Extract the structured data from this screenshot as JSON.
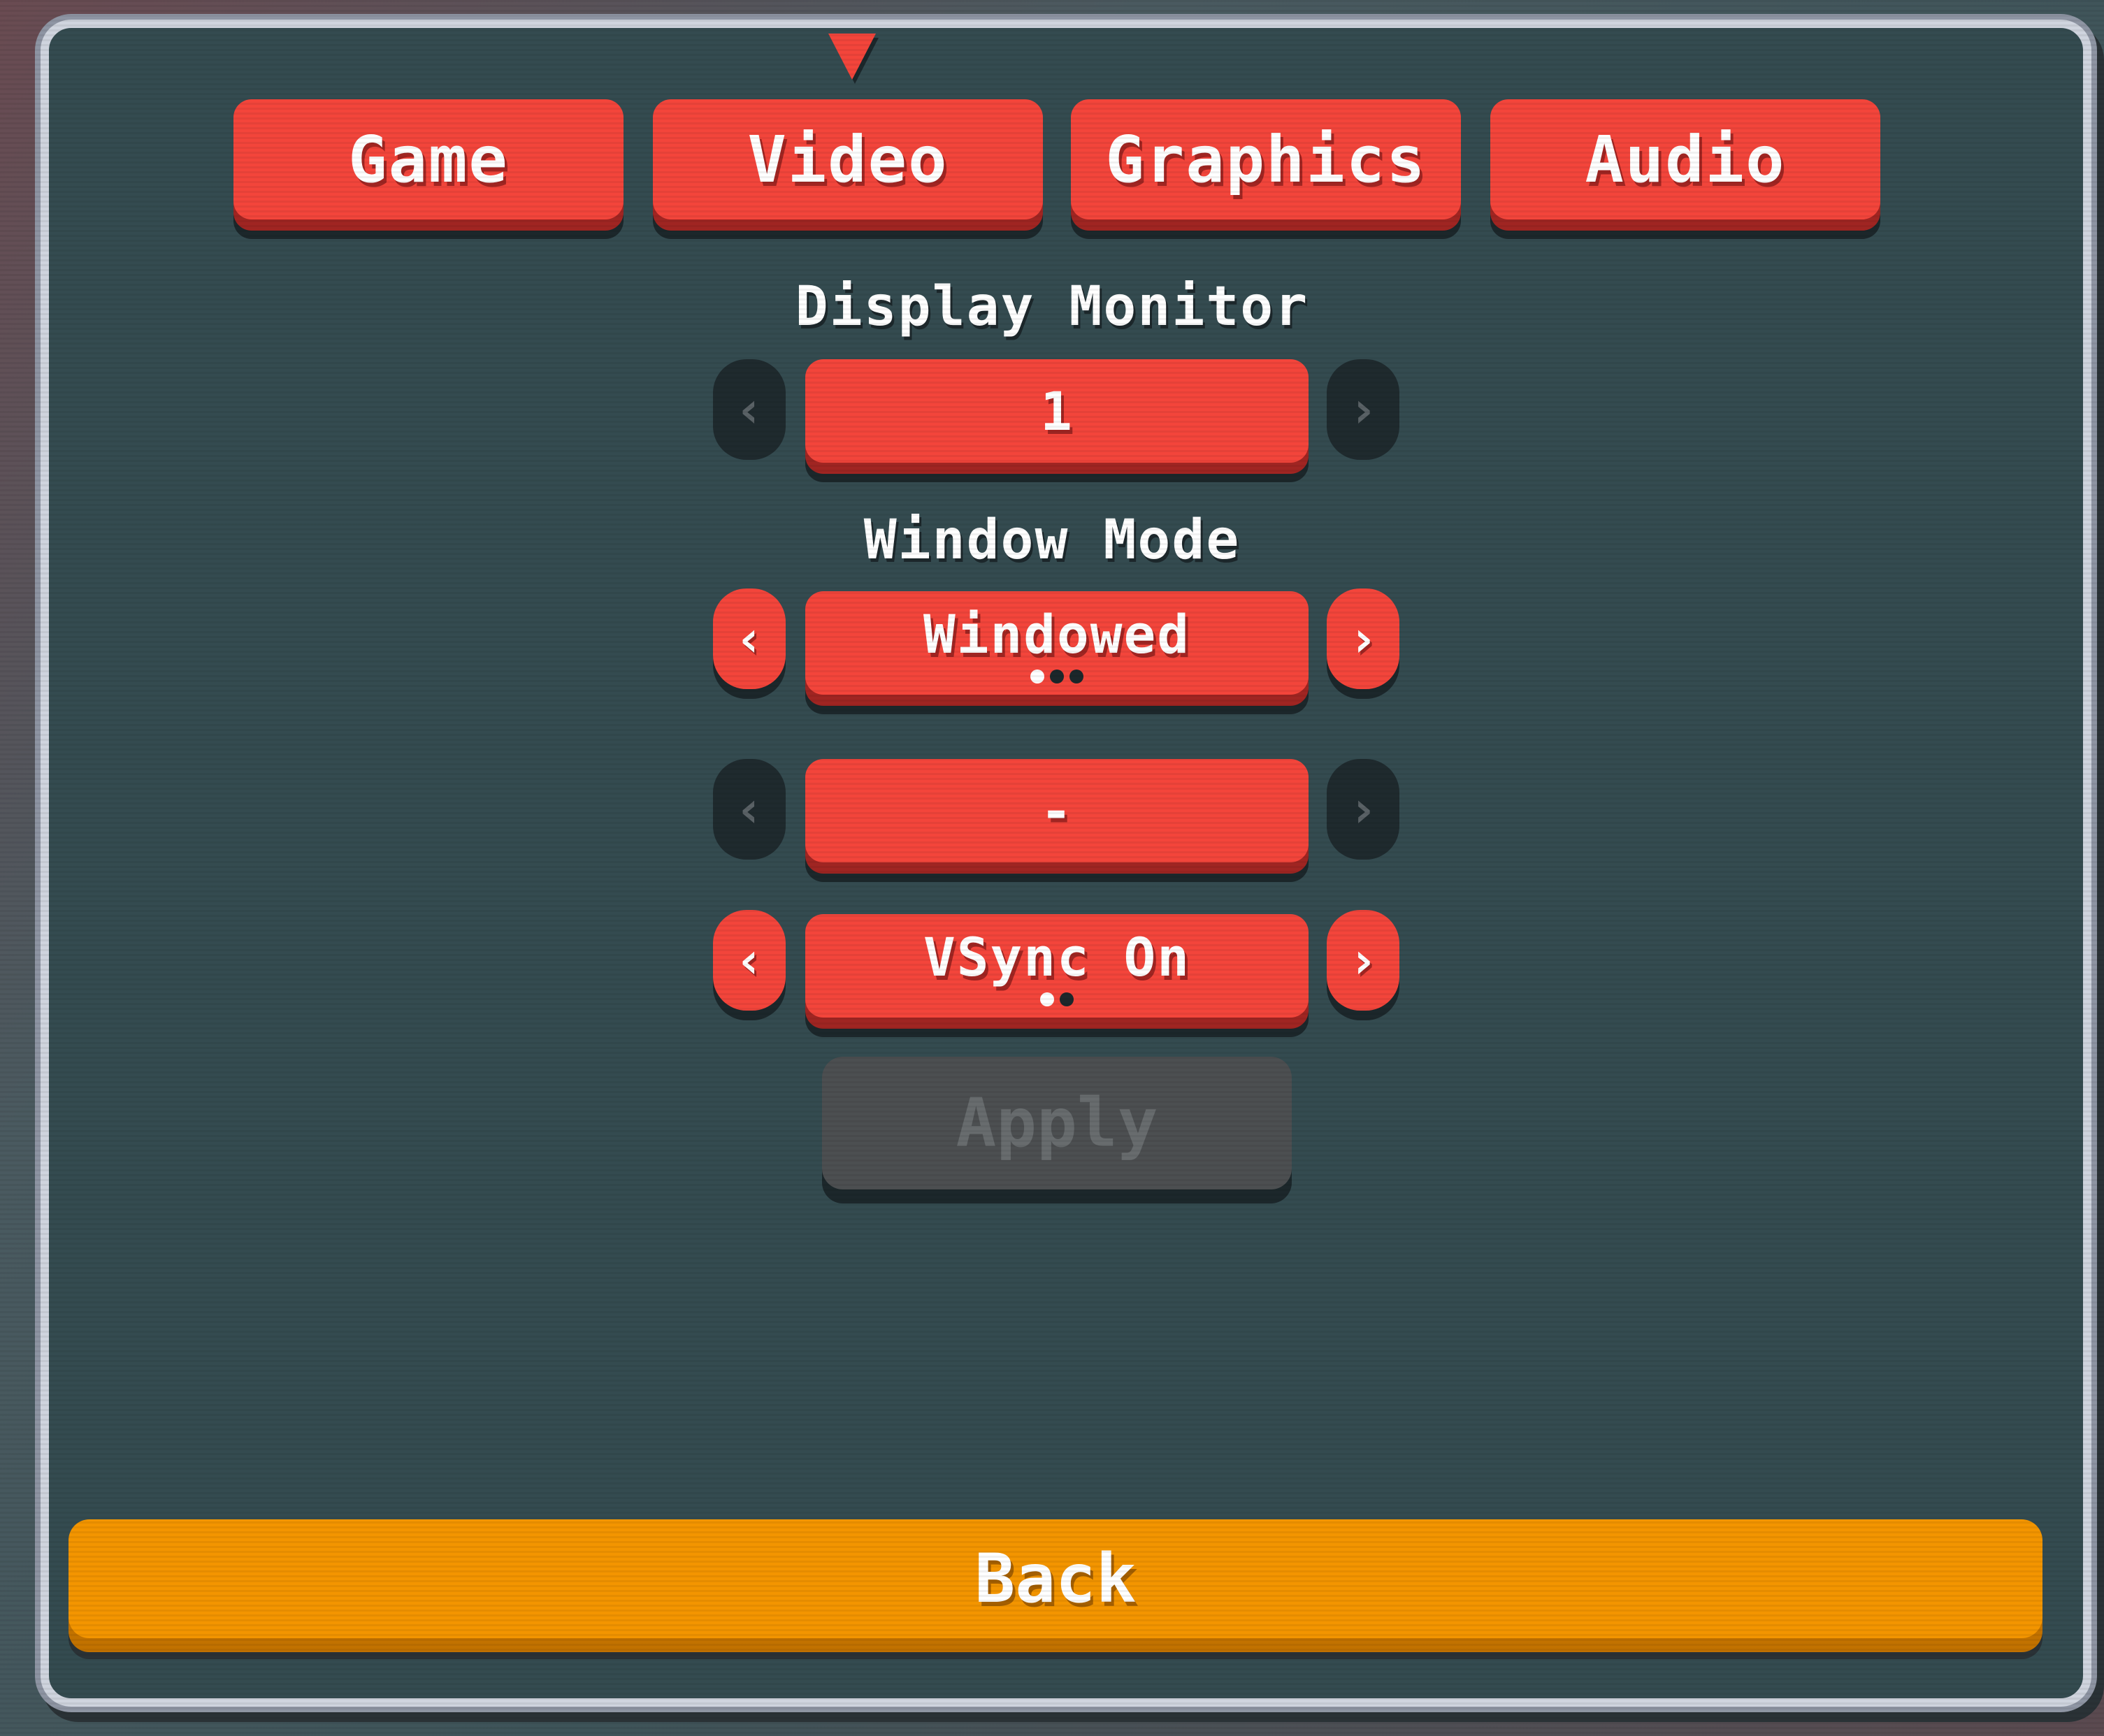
{
  "tabs": [
    {
      "label": "Game",
      "selected": false
    },
    {
      "label": "Video",
      "selected": true
    },
    {
      "label": "Graphics",
      "selected": false
    },
    {
      "label": "Audio",
      "selected": false
    }
  ],
  "settings": [
    {
      "label": "Display Monitor",
      "value": "1",
      "arrows_enabled": false,
      "option_count": 0,
      "option_index": 0
    },
    {
      "label": "Window Mode",
      "value": "Windowed",
      "arrows_enabled": true,
      "option_count": 3,
      "option_index": 0
    },
    {
      "label": "",
      "value": "-",
      "arrows_enabled": false,
      "option_count": 0,
      "option_index": 0
    },
    {
      "label": "",
      "value": "VSync On",
      "arrows_enabled": true,
      "option_count": 2,
      "option_index": 0
    }
  ],
  "icons": {
    "prev": "‹",
    "next": "›"
  },
  "apply_label": "Apply",
  "apply_enabled": false,
  "back_label": "Back"
}
